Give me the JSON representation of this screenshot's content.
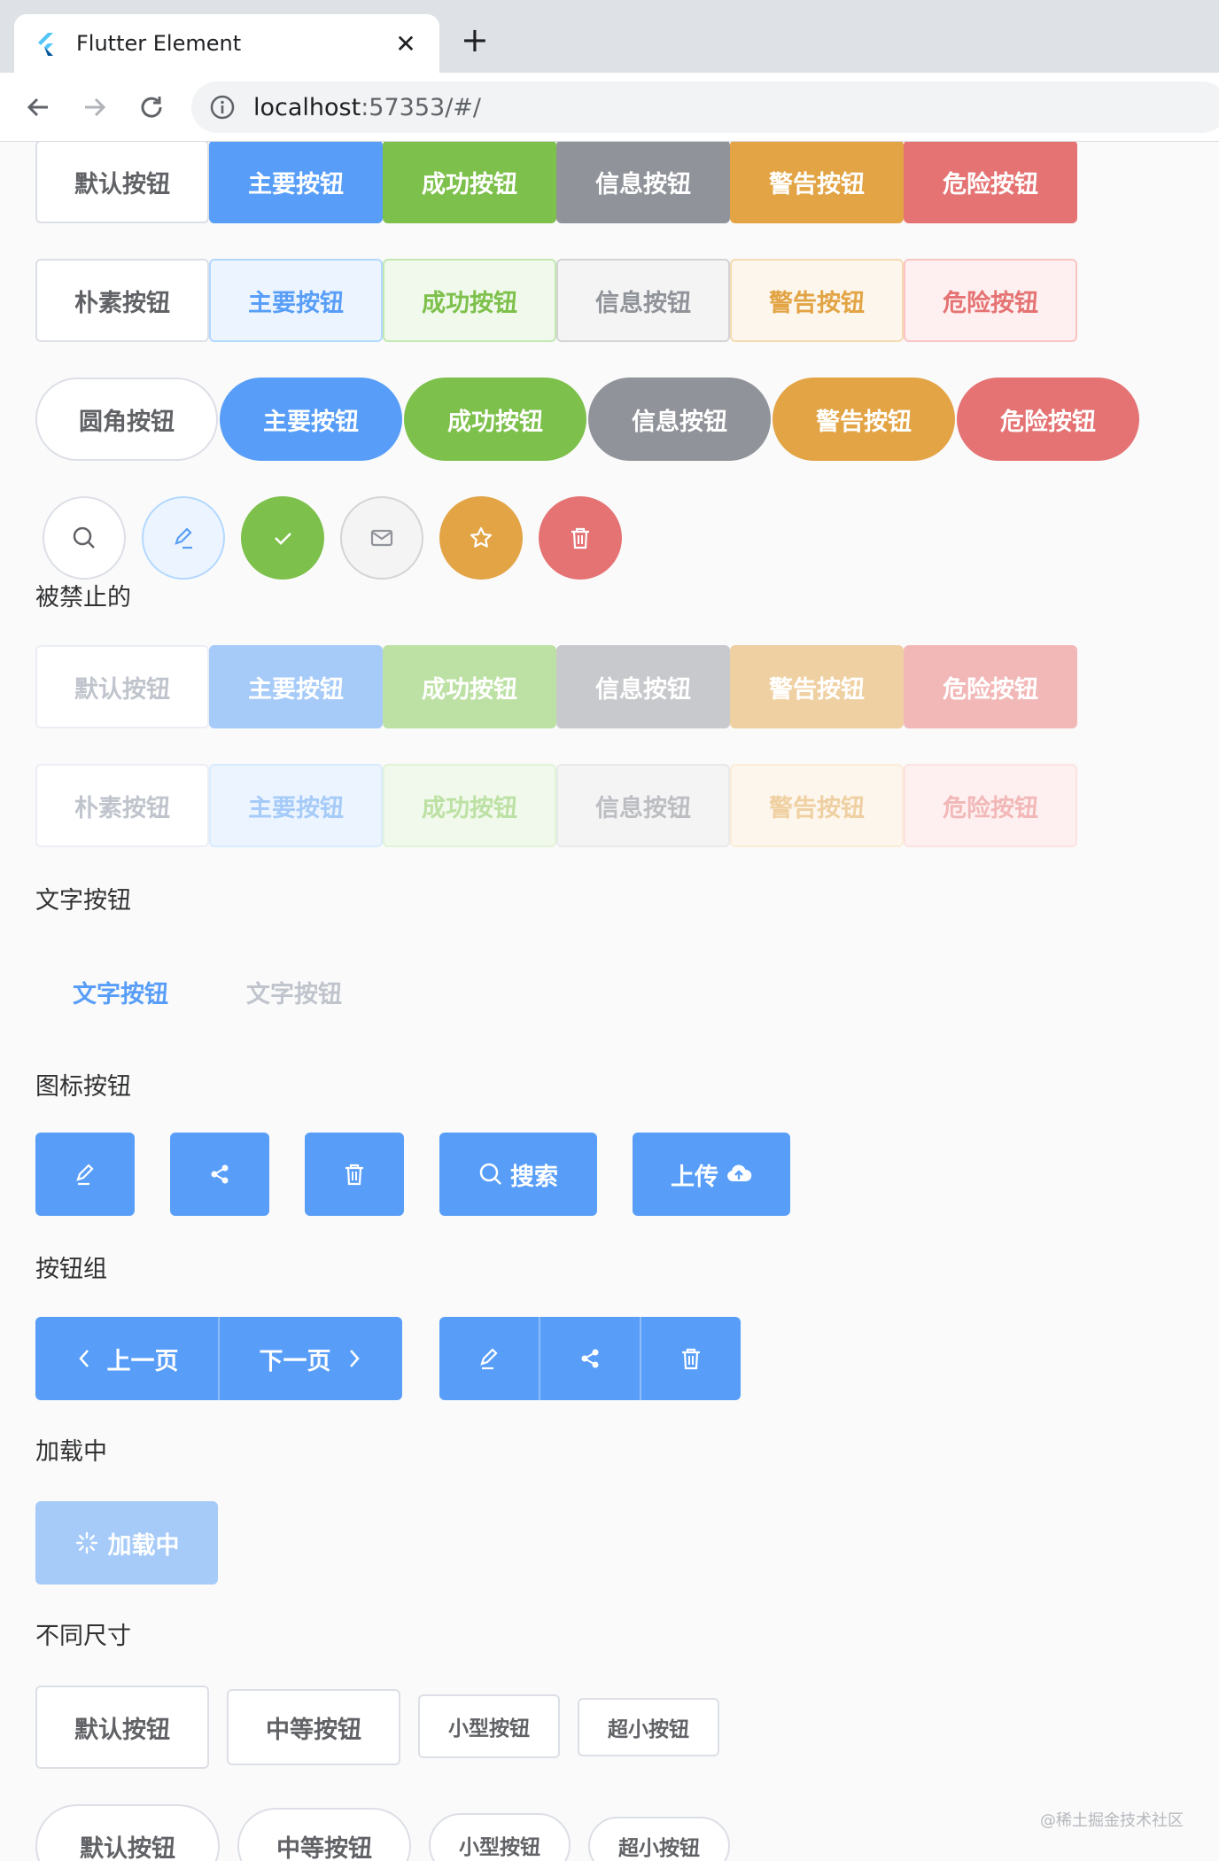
{
  "browser": {
    "tab_title": "Flutter Element",
    "url_host": "localhost",
    "url_rest": ":57353/#/"
  },
  "colors": {
    "primary": "#589ef8",
    "success": "#7dc04b",
    "info": "#909399",
    "warning": "#e2a445",
    "danger": "#e57373"
  },
  "rows": {
    "basic": [
      "默认按钮",
      "主要按钮",
      "成功按钮",
      "信息按钮",
      "警告按钮",
      "危险按钮"
    ],
    "plain": [
      "朴素按钮",
      "主要按钮",
      "成功按钮",
      "信息按钮",
      "警告按钮",
      "危险按钮"
    ],
    "round": [
      "圆角按钮",
      "主要按钮",
      "成功按钮",
      "信息按钮",
      "警告按钮",
      "危险按钮"
    ],
    "circle_icons": [
      "search-icon",
      "edit-icon",
      "check-icon",
      "message-icon",
      "star-icon",
      "delete-icon"
    ]
  },
  "disabled": {
    "label": "被禁止的",
    "basic": [
      "默认按钮",
      "主要按钮",
      "成功按钮",
      "信息按钮",
      "警告按钮",
      "危险按钮"
    ],
    "plain": [
      "朴素按钮",
      "主要按钮",
      "成功按钮",
      "信息按钮",
      "警告按钮",
      "危险按钮"
    ]
  },
  "text_buttons": {
    "label": "文字按钮",
    "enabled": "文字按钮",
    "disabled": "文字按钮"
  },
  "icon_buttons": {
    "label": "图标按钮",
    "search": "搜索",
    "upload": "上传"
  },
  "button_group": {
    "label": "按钮组",
    "prev": "上一页",
    "next": "下一页"
  },
  "loading": {
    "label": "加载中",
    "button": "加载中"
  },
  "sizes": {
    "label": "不同尺寸",
    "square": [
      "默认按钮",
      "中等按钮",
      "小型按钮",
      "超小按钮"
    ],
    "round": [
      "默认按钮",
      "中等按钮",
      "小型按钮",
      "超小按钮"
    ]
  },
  "watermark": "@稀土掘金技术社区"
}
